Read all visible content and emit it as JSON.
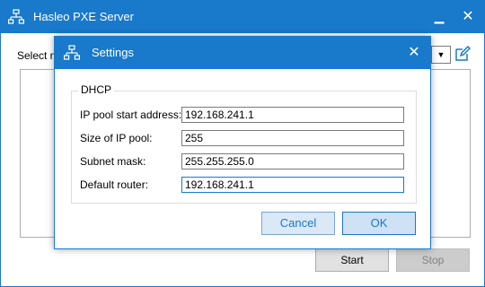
{
  "main_window": {
    "title": "Hasleo PXE Server",
    "select_label": "Select n",
    "start_label": "Start",
    "stop_label": "Stop"
  },
  "settings": {
    "title": "Settings",
    "group_label": "DHCP",
    "fields": [
      {
        "label": "IP pool start address:",
        "value": "192.168.241.1"
      },
      {
        "label": "Size of IP pool:",
        "value": "255"
      },
      {
        "label": "Subnet mask:",
        "value": "255.255.255.0"
      },
      {
        "label": "Default router:",
        "value": "192.168.241.1"
      }
    ],
    "cancel_label": "Cancel",
    "ok_label": "OK"
  },
  "icons": {
    "app": "network-icon",
    "minimize": "minimize-icon",
    "close": "close-icon",
    "dropdown": "chevron-down-icon",
    "edit": "edit-icon"
  },
  "colors": {
    "accent": "#1979ca",
    "disabled_button": "#cccccc"
  }
}
